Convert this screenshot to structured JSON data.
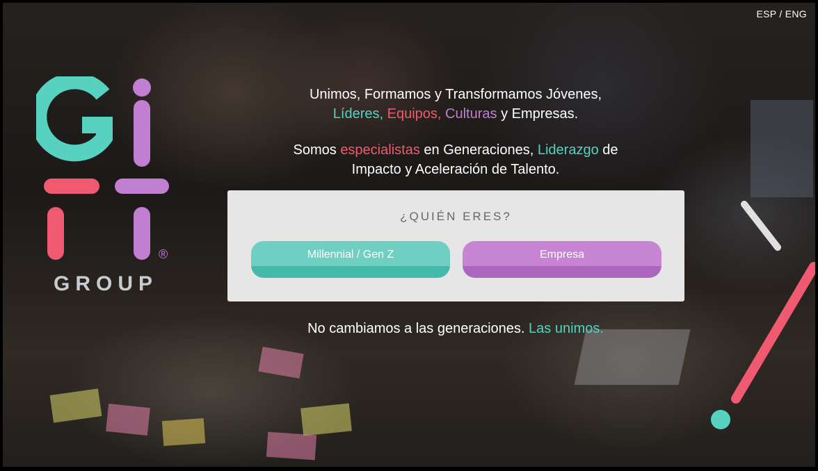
{
  "language": {
    "esp": "ESP",
    "separator": "/",
    "eng": "ENG"
  },
  "logo": {
    "wordmark": "GROUP",
    "registered": "®",
    "glyphs": "Gi Fi"
  },
  "hero": {
    "line1": "Unimos, Formamos y Transformamos Jóvenes,",
    "line2_lideres": "Líderes,",
    "line2_equipos": "Equipos,",
    "line2_culturas": "Culturas",
    "line2_rest": "y Empresas.",
    "line3_a": "Somos",
    "line3_especialistas": "especialistas",
    "line3_b": "en Generaciones,",
    "line3_liderazgo": "Liderazgo",
    "line3_c": "de",
    "line4": "Impacto y Aceleración de Talento."
  },
  "chooser": {
    "title": "¿QUIÉN ERES?",
    "millennial_label": "Millennial / Gen Z",
    "empresa_label": "Empresa"
  },
  "footer": {
    "text": "No cambiamos a las generaciones.",
    "link": "Las unimos."
  },
  "colors": {
    "teal": "#57d2c0",
    "pink": "#ef5a70",
    "purple": "#c07fd0",
    "card_bg": "#e6e6e6"
  }
}
